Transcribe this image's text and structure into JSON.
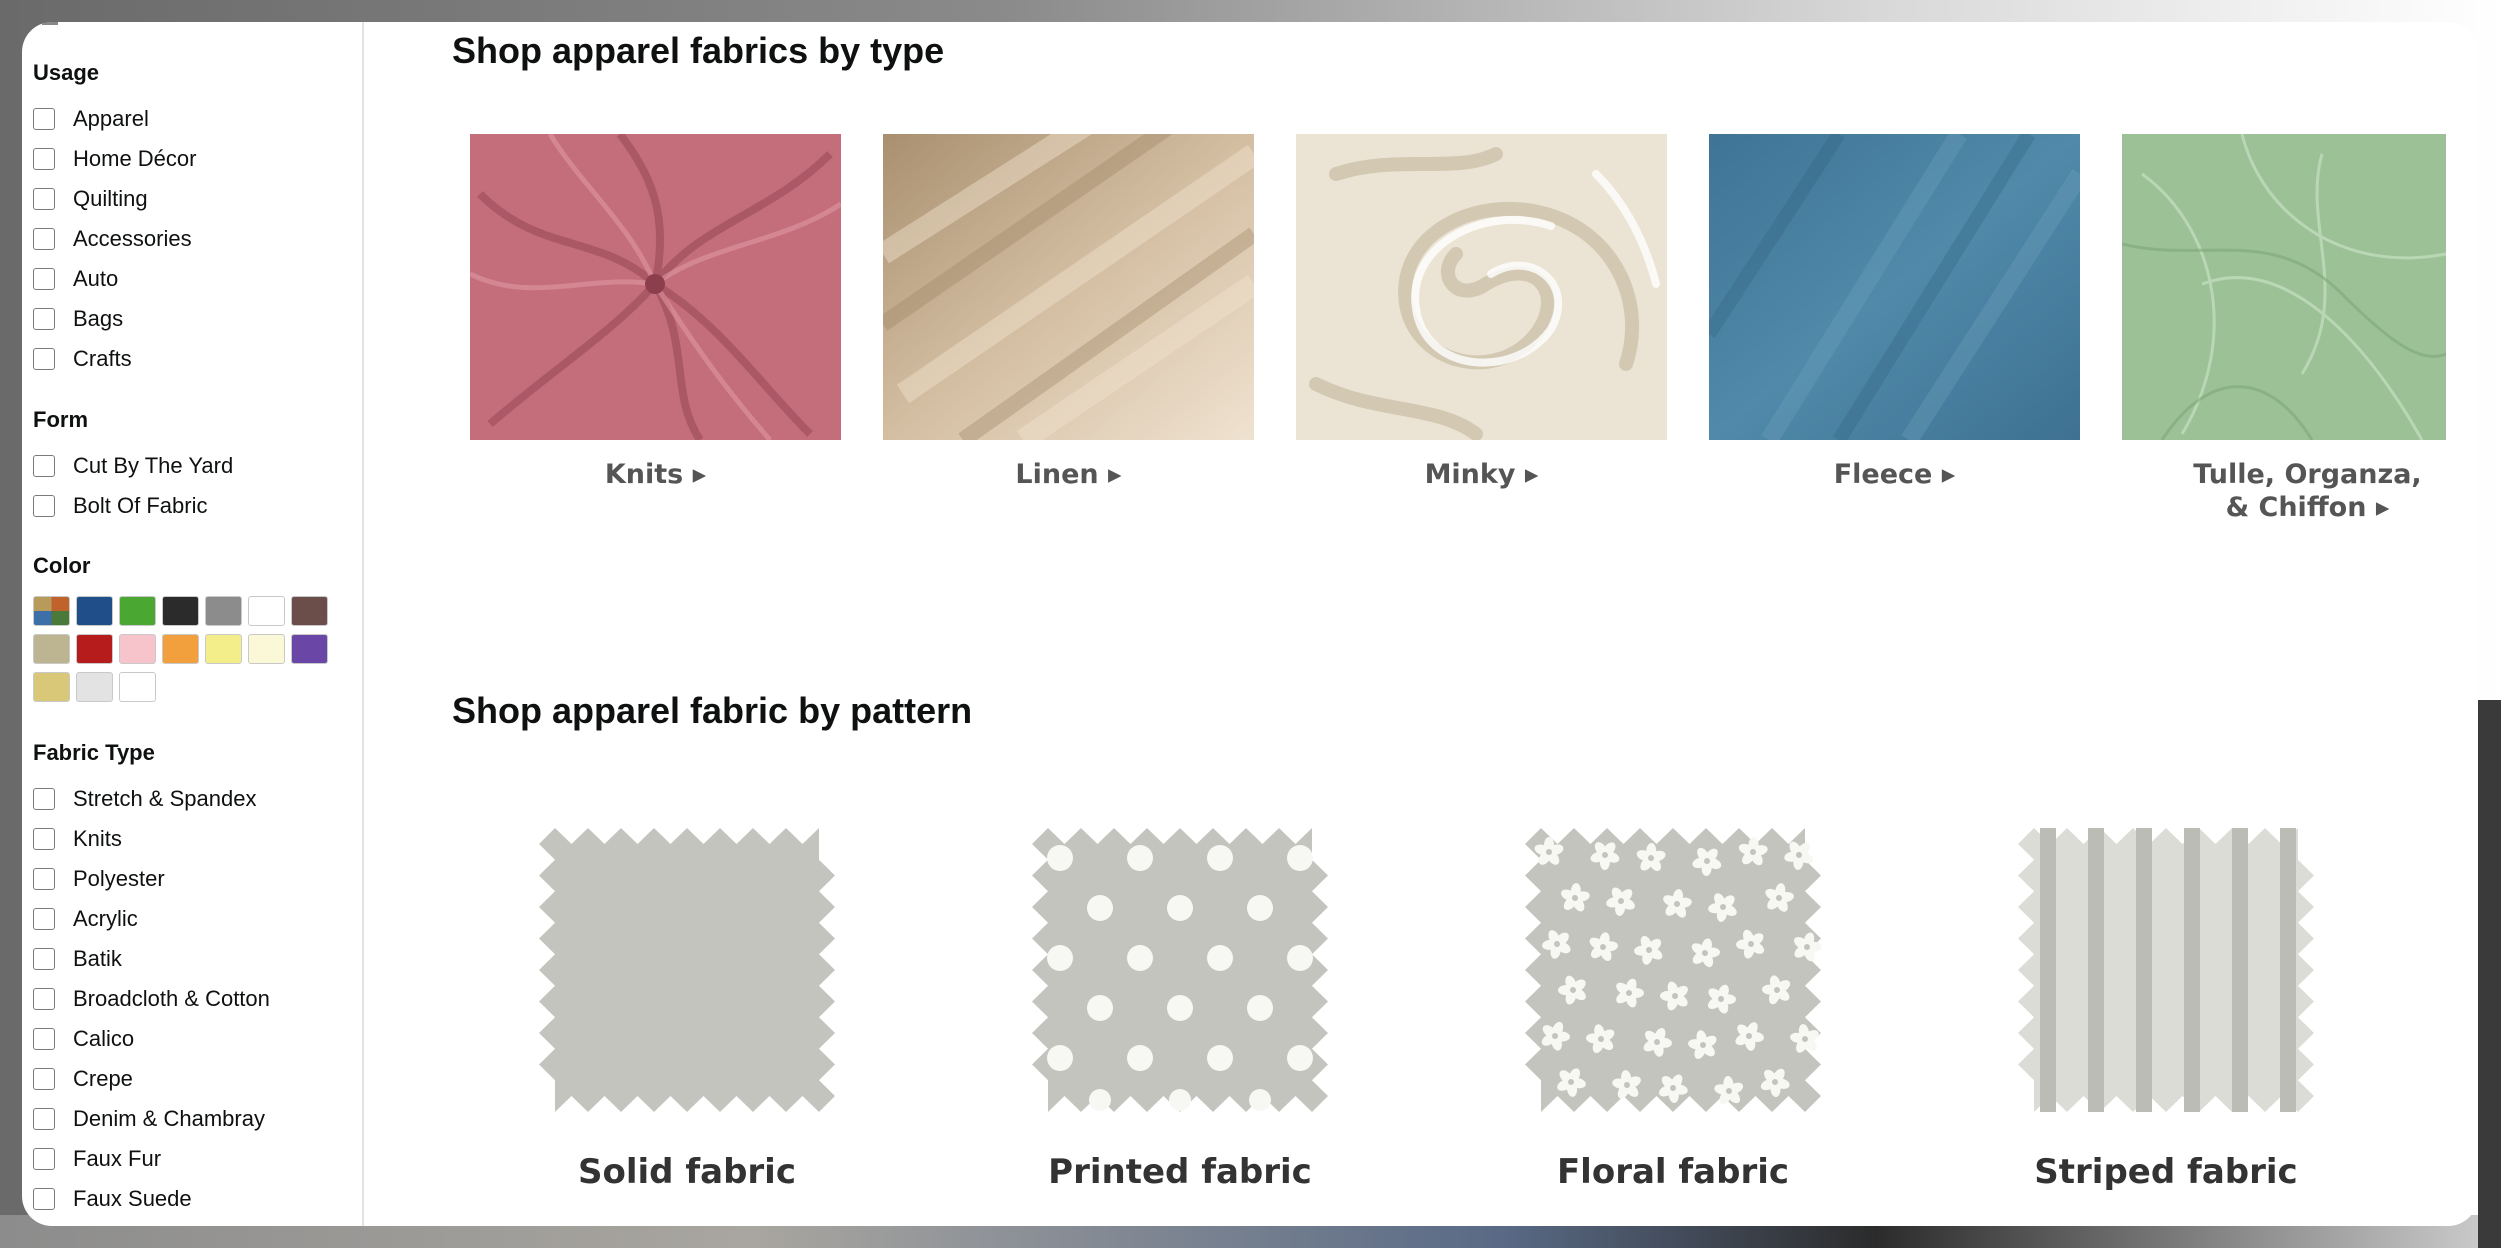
{
  "sidebar": {
    "usage": {
      "title": "Usage",
      "options": [
        "Apparel",
        "Home Décor",
        "Quilting",
        "Accessories",
        "Auto",
        "Bags",
        "Crafts"
      ]
    },
    "form": {
      "title": "Form",
      "options": [
        "Cut By The Yard",
        "Bolt Of Fabric"
      ]
    },
    "color": {
      "title": "Color",
      "swatches": [
        {
          "name": "multi-color-swatch",
          "color": "multi"
        },
        {
          "name": "blue-swatch",
          "color": "#1f4e89"
        },
        {
          "name": "green-swatch",
          "color": "#4aa832"
        },
        {
          "name": "black-swatch",
          "color": "#2b2b2b"
        },
        {
          "name": "gray-swatch",
          "color": "#8c8c8c"
        },
        {
          "name": "white-swatch",
          "color": "#ffffff"
        },
        {
          "name": "brown-swatch",
          "color": "#6b4e4a"
        },
        {
          "name": "beige-swatch",
          "color": "#bdb592"
        },
        {
          "name": "red-swatch",
          "color": "#b71c1c"
        },
        {
          "name": "pink-swatch",
          "color": "#f7c4cb"
        },
        {
          "name": "orange-swatch",
          "color": "#f2a03d"
        },
        {
          "name": "yellow-swatch",
          "color": "#f3ee8a"
        },
        {
          "name": "ivory-swatch",
          "color": "#fbf8d8"
        },
        {
          "name": "purple-swatch",
          "color": "#6a47a6"
        },
        {
          "name": "gold-swatch",
          "color": "#d9c878"
        },
        {
          "name": "silver-swatch",
          "color": "#e3e3e3"
        },
        {
          "name": "clear-swatch",
          "color": "#ffffff"
        }
      ]
    },
    "fabric_type": {
      "title": "Fabric Type",
      "options": [
        "Stretch & Spandex",
        "Knits",
        "Polyester",
        "Acrylic",
        "Batik",
        "Broadcloth & Cotton",
        "Calico",
        "Crepe",
        "Denim & Chambray",
        "Faux Fur",
        "Faux Suede"
      ]
    }
  },
  "main": {
    "types_title": "Shop apparel fabrics by type",
    "types": [
      {
        "label": "Knits ▸",
        "color": "#c46e7b"
      },
      {
        "label": "Linen ▸",
        "color": "#cfb79b"
      },
      {
        "label": "Minky ▸",
        "color": "#ebe3d3"
      },
      {
        "label": "Fleece ▸",
        "color": "#4b7fa0"
      },
      {
        "label_line1": "Tulle, Organza,",
        "label_line2": "& Chiffon ▸",
        "color": "#9cc197"
      }
    ],
    "patterns_title": "Shop apparel fabric by pattern",
    "patterns": [
      {
        "label": "Solid fabric"
      },
      {
        "label": "Printed fabric"
      },
      {
        "label": "Floral fabric"
      },
      {
        "label": "Striped fabric"
      }
    ],
    "pattern_color": "#c4c4bf"
  }
}
